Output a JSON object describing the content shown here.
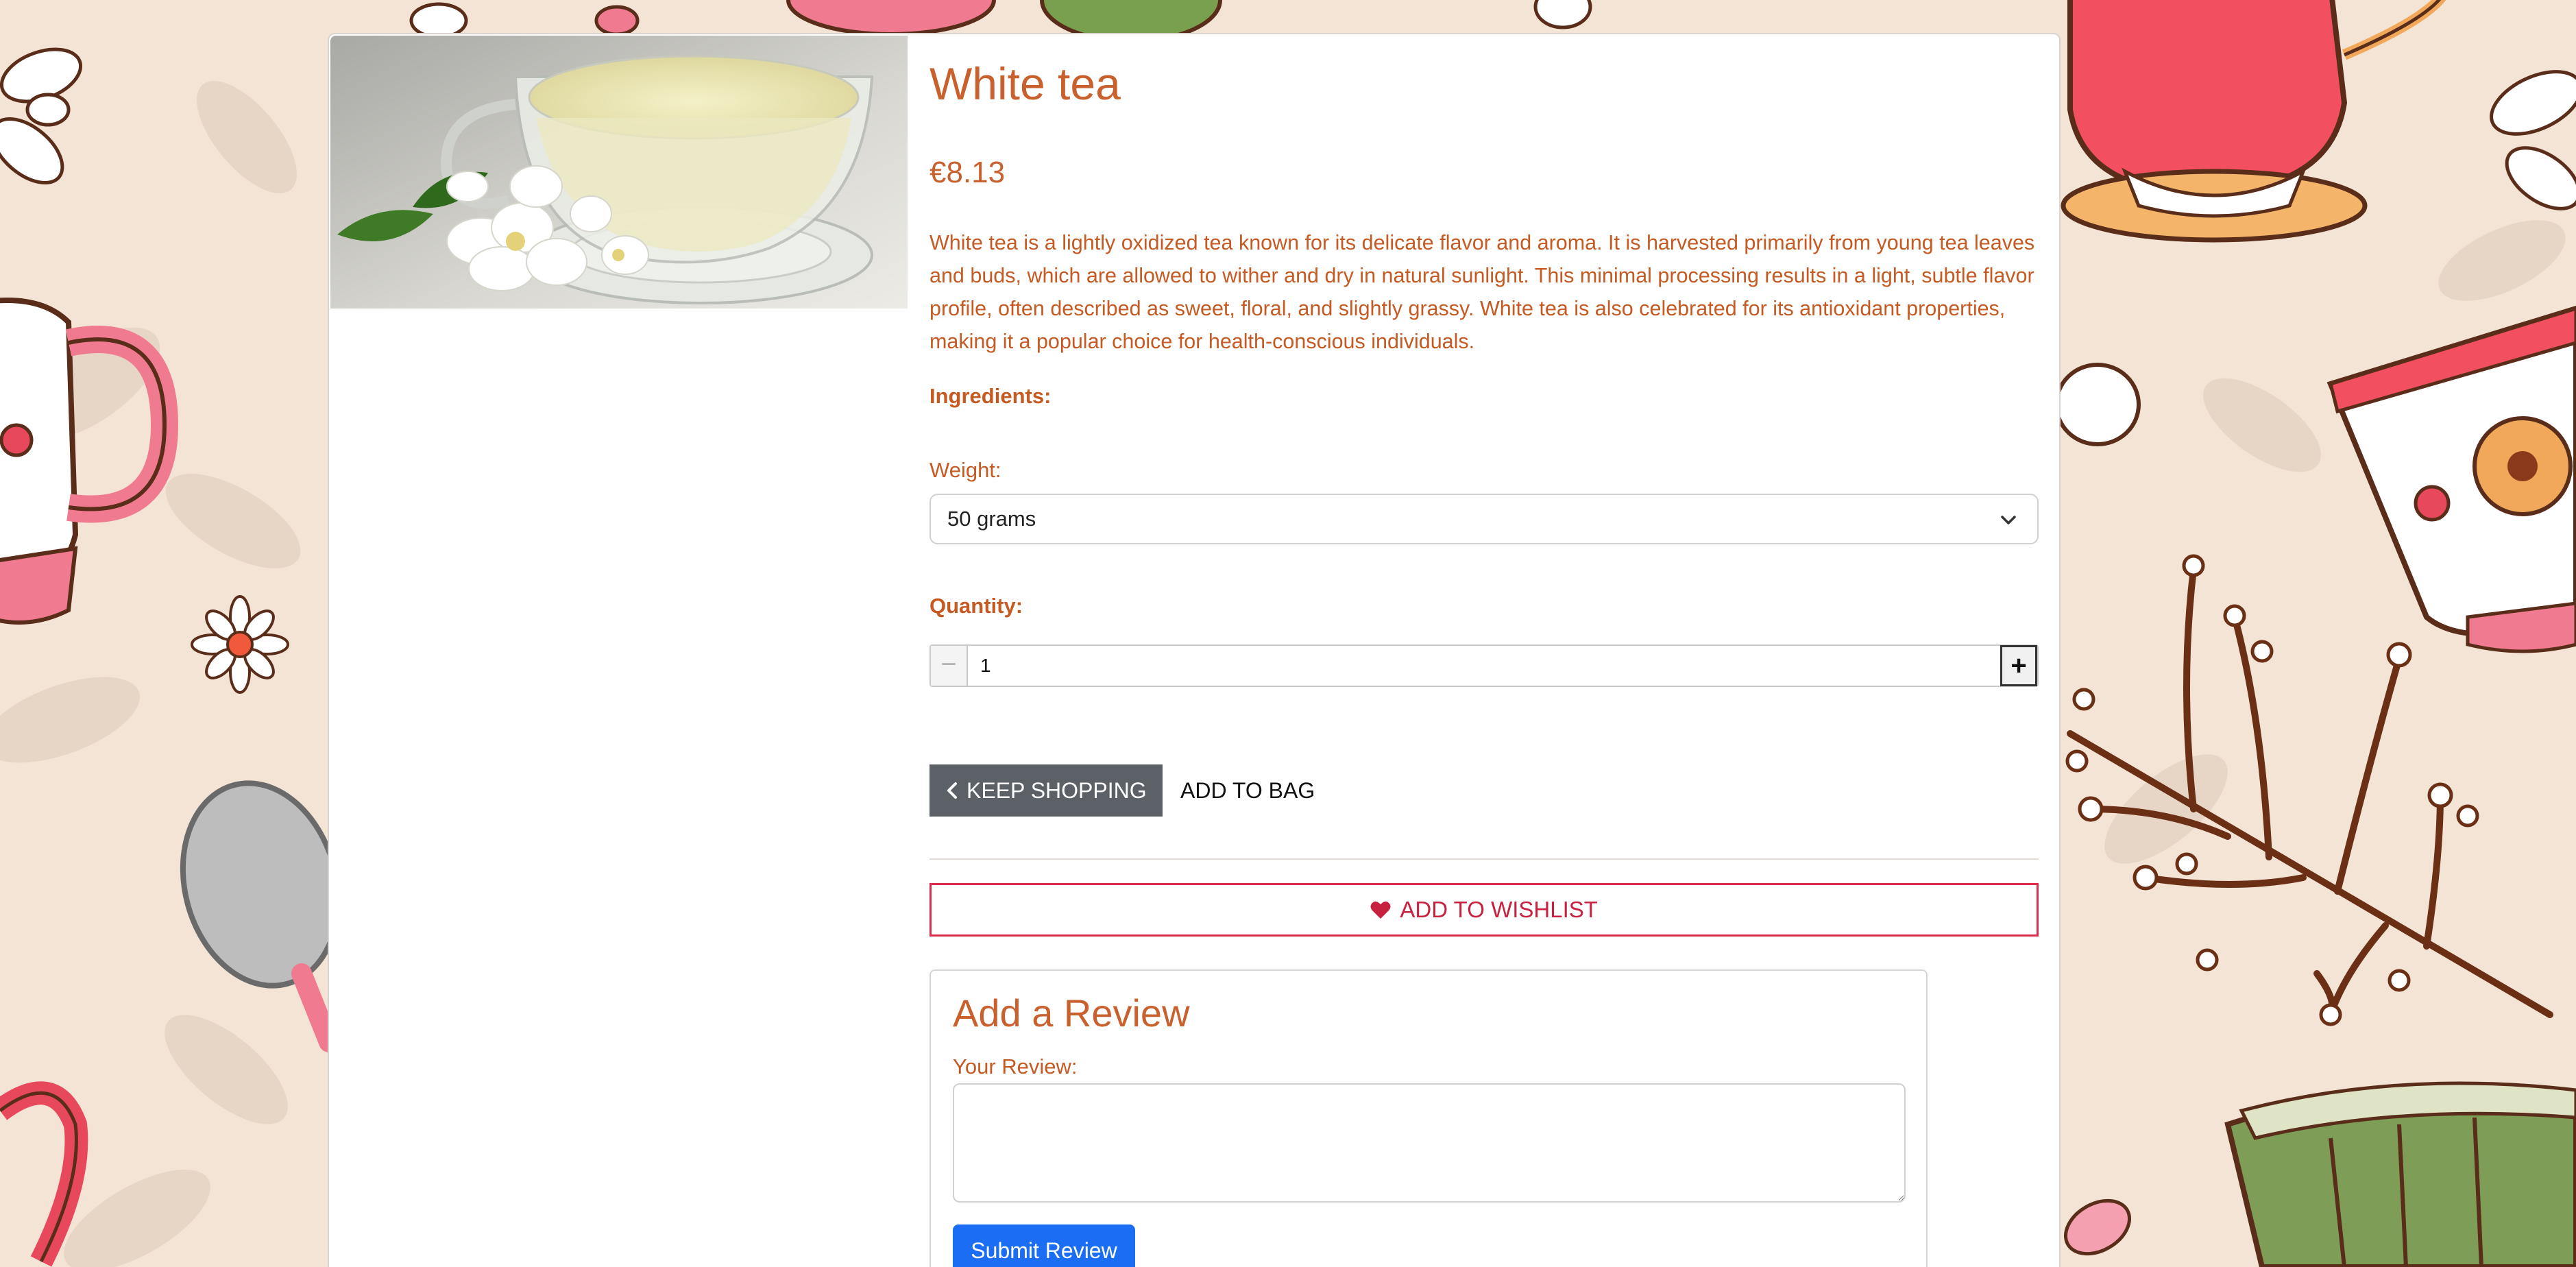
{
  "product": {
    "title": "White tea",
    "price": "€8.13",
    "description": "White tea is a lightly oxidized tea known for its delicate flavor and aroma. It is harvested primarily from young tea leaves and buds, which are allowed to wither and dry in natural sunlight. This minimal processing results in a light, subtle flavor profile, often described as sweet, floral, and slightly grassy. White tea is also celebrated for its antioxidant properties, making it a popular choice for health-conscious individuals.",
    "ingredients_label": "Ingredients:"
  },
  "weight": {
    "label": "Weight:",
    "selected": "50 grams"
  },
  "quantity": {
    "label": "Quantity:",
    "value": "1",
    "minus": "−",
    "plus": "+"
  },
  "actions": {
    "keep_shopping": "KEEP SHOPPING",
    "add_to_bag": "ADD TO BAG",
    "add_to_wishlist": "ADD TO WISHLIST"
  },
  "review": {
    "title": "Add a Review",
    "label": "Your Review:",
    "submit": "Submit Review"
  },
  "colors": {
    "accent_orange": "#c8612e",
    "keep_shopping_bg": "#5b6167",
    "wishlist_red": "#dc2e4c",
    "submit_blue": "#1b6ef3",
    "page_bg": "#f3e4d6"
  }
}
